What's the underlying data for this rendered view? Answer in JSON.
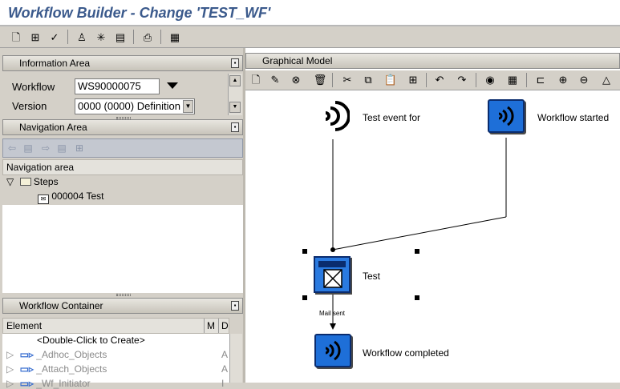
{
  "window": {
    "title": "Workflow Builder - Change 'TEST_WF'"
  },
  "toolbar": {
    "icons": [
      "new-icon",
      "save-local-icon",
      "check-icon",
      "activate-icon",
      "generate-icon",
      "test-icon",
      "print-icon",
      "list-icon"
    ]
  },
  "info_area": {
    "title": "Information Area",
    "workflow_label": "Workflow",
    "workflow_value": "WS90000075",
    "version_label": "Version",
    "version_value": "0000 (0000) Definition"
  },
  "nav_area": {
    "title": "Navigation Area",
    "column": "Navigation area",
    "tree": {
      "steps_label": "Steps",
      "step_item": "000004 Test"
    }
  },
  "container": {
    "title": "Workflow Container",
    "col_element": "Element",
    "col_m": "M",
    "col_d": "D",
    "create_hint": "<Double-Click to Create>",
    "rows": [
      {
        "name": "_Adhoc_Objects",
        "desc": "A"
      },
      {
        "name": "_Attach_Objects",
        "desc": "A"
      },
      {
        "name": "_Wf_Initiator",
        "desc": "I"
      }
    ]
  },
  "graph": {
    "title": "Graphical Model",
    "nodes": {
      "event_label": "Test event for",
      "started_label": "Workflow started",
      "step_label": "Test",
      "outcome_label": "Mail sent",
      "completed_label": "Workflow completed"
    }
  },
  "colors": {
    "title": "#3b5a8c",
    "event_blue": "#1e6fd8",
    "nav_toolbar": "#c4c8d0"
  }
}
